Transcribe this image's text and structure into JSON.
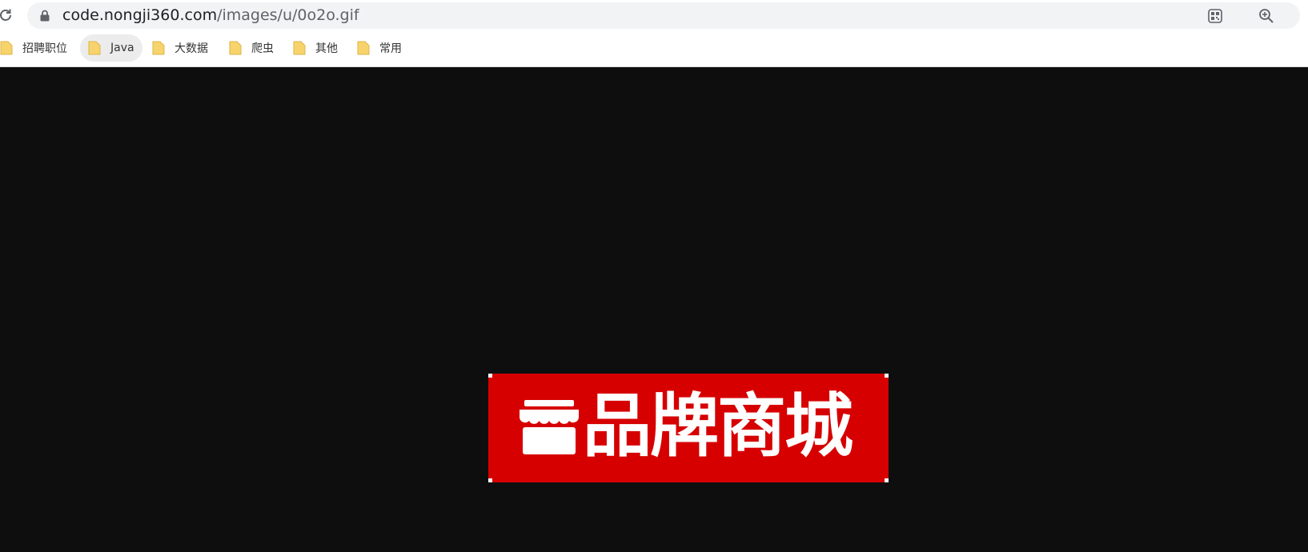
{
  "address_bar": {
    "url_host": "code.nongji360.com",
    "url_path": "/images/u/0o2o.gif"
  },
  "bookmarks": [
    {
      "label": "招聘职位",
      "icon": "folder-icon"
    },
    {
      "label": "Java",
      "icon": "folder-icon"
    },
    {
      "label": "大数据",
      "icon": "folder-icon"
    },
    {
      "label": "爬虫",
      "icon": "folder-icon"
    },
    {
      "label": "其他",
      "icon": "folder-icon"
    },
    {
      "label": "常用",
      "icon": "folder-icon"
    }
  ],
  "image": {
    "text": "品牌商城",
    "icon": "storefront-icon",
    "background_color": "#d60000",
    "text_color": "#ffffff"
  },
  "colors": {
    "viewport_background": "#0e0e0e",
    "folder": "#f6d36b",
    "omnibox": "#f1f3f4"
  }
}
